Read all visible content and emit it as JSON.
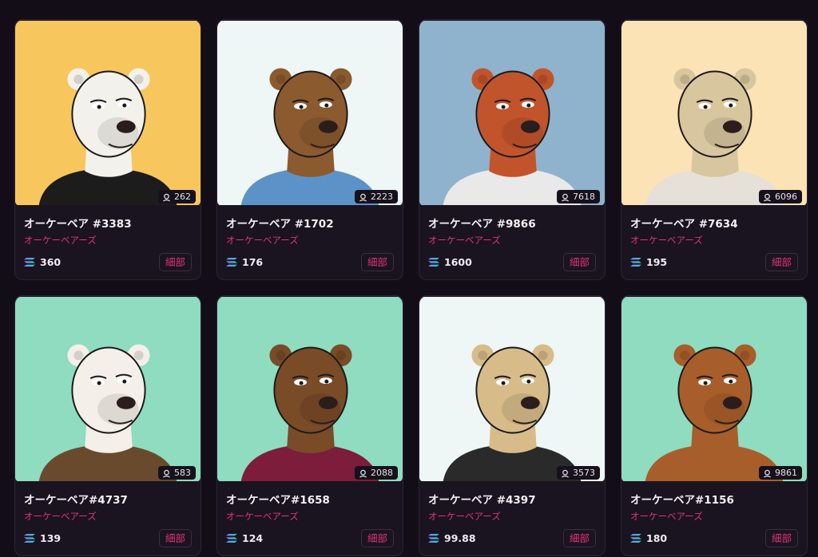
{
  "cards": [
    {
      "title": "オーケーベア #3383",
      "collection": "オーケーベアーズ",
      "likes": "262",
      "price": "360",
      "details_label": "細部",
      "bg": "#f7c75d",
      "fur": "#f3f1ec",
      "top": "#1c1c1c"
    },
    {
      "title": "オーケーベア #1702",
      "collection": "オーケーベアーズ",
      "likes": "2223",
      "price": "176",
      "details_label": "細部",
      "bg": "#eef6f6",
      "fur": "#8b5a2e",
      "top": "#5b93c8"
    },
    {
      "title": "オーケーベア #9866",
      "collection": "オーケーベアーズ",
      "likes": "7618",
      "price": "1600",
      "details_label": "細部",
      "bg": "#8fb3cc",
      "fur": "#c2542c",
      "top": "#e9e9e9"
    },
    {
      "title": "オーケーベア #7634",
      "collection": "オーケーベアーズ",
      "likes": "6096",
      "price": "195",
      "details_label": "細部",
      "bg": "#fbe3b6",
      "fur": "#d8c79e",
      "top": "#e5e1d8"
    },
    {
      "title": "オーケーベア#4737",
      "collection": "オーケーベアーズ",
      "likes": "583",
      "price": "139",
      "details_label": "細部",
      "bg": "#8fdcc0",
      "fur": "#f4efe8",
      "top": "#6a4a2d"
    },
    {
      "title": "オーケーベア#1658",
      "collection": "オーケーベアーズ",
      "likes": "2088",
      "price": "124",
      "details_label": "細部",
      "bg": "#8fdcc0",
      "fur": "#7a4b27",
      "top": "#7c1d3c"
    },
    {
      "title": "オーケーベア #4397",
      "collection": "オーケーベアーズ",
      "likes": "3573",
      "price": "99.88",
      "details_label": "細部",
      "bg": "#eef6f6",
      "fur": "#d7bc8a",
      "top": "#2a2a2a"
    },
    {
      "title": "オーケーベア#1156",
      "collection": "オーケーベアーズ",
      "likes": "9861",
      "price": "180",
      "details_label": "細部",
      "bg": "#8fdcc0",
      "fur": "#a85e2a",
      "top": "#a85e2a"
    }
  ],
  "icons": {
    "likes": "user-outline-icon",
    "currency": "solana-icon"
  }
}
